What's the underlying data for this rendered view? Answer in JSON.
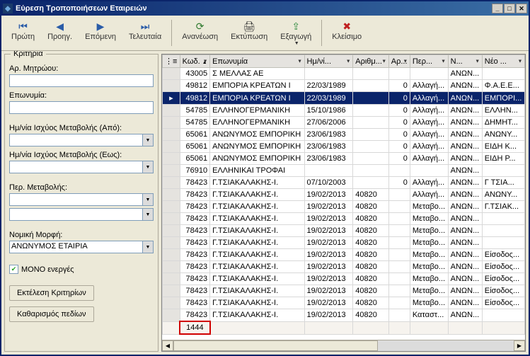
{
  "window": {
    "title": "Εύρεση Τροποποιήσεων Εταιρειών"
  },
  "toolbar": {
    "first": "Πρώτη",
    "prev": "Προηγ.",
    "next": "Επόμενη",
    "last": "Τελευταία",
    "refresh": "Ανανέωση",
    "print": "Εκτύπωση",
    "export": "Εξαγωγή",
    "close": "Κλείσιμο"
  },
  "criteria": {
    "legend": "Κριτήρια",
    "registryLabel": "Αρ. Μητρώου:",
    "nameLabel": "Επωνυμία:",
    "dateFromLabel": "Ημ/νία Ισχύος Μεταβολής (Από):",
    "dateToLabel": "Ημ/νία Ισχύος Μεταβολής (Εως):",
    "changeCatLabel": "Περ. Μεταβολής:",
    "legalFormLabel": "Νομική Μορφή:",
    "legalFormValue": "ΑΝΩΝΥΜΟΣ ΕΤΑΙΡΙΑ",
    "onlyActiveLabel": "ΜΟΝΟ ενεργές",
    "runBtn": "Εκτέλεση Κριτηρίων",
    "clearBtn": "Καθαρισμός πεδίων"
  },
  "grid": {
    "headers": [
      "Κωδ.",
      "Επωνυμία",
      "Ημ/νί...",
      "Αριθμ...",
      "Αρ...",
      "Περ...",
      "Ν...",
      "Νέο ..."
    ],
    "rows": [
      {
        "kod": "43005",
        "name": "Σ ΜΕΛΛΑΣ ΑΕ",
        "date": "",
        "num": "",
        "ar": "",
        "per": "",
        "n": "ΑΝΩΝ...",
        "neo": "",
        "sel": false
      },
      {
        "kod": "49812",
        "name": "ΕΜΠΟΡΙΑ ΚΡΕΑΤΩΝ Ι",
        "date": "22/03/1989",
        "num": "",
        "ar": "0",
        "per": "Αλλαγή...",
        "n": "ΑΝΩΝ...",
        "neo": "Φ.Α.Ε.Ε...",
        "sel": false
      },
      {
        "kod": "49812",
        "name": "ΕΜΠΟΡΙΑ ΚΡΕΑΤΩΝ Ι",
        "date": "22/03/1989",
        "num": "",
        "ar": "0",
        "per": "Αλλαγή...",
        "n": "ΑΝΩΝ...",
        "neo": "ΕΜΠΟΡΙ...",
        "sel": true
      },
      {
        "kod": "54785",
        "name": "ΕΛΛΗΝΟΓΕΡΜΑΝΙΚΗ",
        "date": "15/10/1986",
        "num": "",
        "ar": "0",
        "per": "Αλλαγή...",
        "n": "ΑΝΩΝ...",
        "neo": "ΕΛΛΗΝ...",
        "sel": false
      },
      {
        "kod": "54785",
        "name": "ΕΛΛΗΝΟΓΕΡΜΑΝΙΚΗ",
        "date": "27/06/2006",
        "num": "",
        "ar": "0",
        "per": "Αλλαγή...",
        "n": "ΑΝΩΝ...",
        "neo": "ΔΗΜΗΤ...",
        "sel": false
      },
      {
        "kod": "65061",
        "name": "ΑΝΩΝΥΜΟΣ ΕΜΠΟΡΙΚΗ",
        "date": "23/06/1983",
        "num": "",
        "ar": "0",
        "per": "Αλλαγή...",
        "n": "ΑΝΩΝ...",
        "neo": "ΑΝΩΝΥ...",
        "sel": false
      },
      {
        "kod": "65061",
        "name": "ΑΝΩΝΥΜΟΣ ΕΜΠΟΡΙΚΗ",
        "date": "23/06/1983",
        "num": "",
        "ar": "0",
        "per": "Αλλαγή...",
        "n": "ΑΝΩΝ...",
        "neo": "ΕΙΔΗ Κ...",
        "sel": false
      },
      {
        "kod": "65061",
        "name": "ΑΝΩΝΥΜΟΣ ΕΜΠΟΡΙΚΗ",
        "date": "23/06/1983",
        "num": "",
        "ar": "0",
        "per": "Αλλαγή...",
        "n": "ΑΝΩΝ...",
        "neo": "ΕΙΔΗ Ρ...",
        "sel": false
      },
      {
        "kod": "76910",
        "name": "ΕΛΛΗΝΙΚΑΙ ΤΡΟΦΑΙ",
        "date": "",
        "num": "",
        "ar": "",
        "per": "",
        "n": "ΑΝΩΝ...",
        "neo": "",
        "sel": false
      },
      {
        "kod": "78423",
        "name": "Γ.ΤΣΙΑΚΑΛΑΚΗΣ-Ι.",
        "date": "07/10/2003",
        "num": "",
        "ar": "0",
        "per": "Αλλαγή...",
        "n": "ΑΝΩΝ...",
        "neo": "Γ  ΤΣΙΑ...",
        "sel": false
      },
      {
        "kod": "78423",
        "name": "Γ.ΤΣΙΑΚΑΛΑΚΗΣ-Ι.",
        "date": "19/02/2013",
        "num": "40820",
        "ar": "",
        "per": "Αλλαγή...",
        "n": "ΑΝΩΝ...",
        "neo": "ΑΝΩΝΥ...",
        "sel": false
      },
      {
        "kod": "78423",
        "name": "Γ.ΤΣΙΑΚΑΛΑΚΗΣ-Ι.",
        "date": "19/02/2013",
        "num": "40820",
        "ar": "",
        "per": "Μεταβο...",
        "n": "ΑΝΩΝ...",
        "neo": "Γ.ΤΣΙΑΚ...",
        "sel": false
      },
      {
        "kod": "78423",
        "name": "Γ.ΤΣΙΑΚΑΛΑΚΗΣ-Ι.",
        "date": "19/02/2013",
        "num": "40820",
        "ar": "",
        "per": "Μεταβο...",
        "n": "ΑΝΩΝ...",
        "neo": "",
        "sel": false
      },
      {
        "kod": "78423",
        "name": "Γ.ΤΣΙΑΚΑΛΑΚΗΣ-Ι.",
        "date": "19/02/2013",
        "num": "40820",
        "ar": "",
        "per": "Μεταβο...",
        "n": "ΑΝΩΝ...",
        "neo": "",
        "sel": false
      },
      {
        "kod": "78423",
        "name": "Γ.ΤΣΙΑΚΑΛΑΚΗΣ-Ι.",
        "date": "19/02/2013",
        "num": "40820",
        "ar": "",
        "per": "Μεταβο...",
        "n": "ΑΝΩΝ...",
        "neo": "",
        "sel": false
      },
      {
        "kod": "78423",
        "name": "Γ.ΤΣΙΑΚΑΛΑΚΗΣ-Ι.",
        "date": "19/02/2013",
        "num": "40820",
        "ar": "",
        "per": "Μεταβο...",
        "n": "ΑΝΩΝ...",
        "neo": "Είσοδος...",
        "sel": false
      },
      {
        "kod": "78423",
        "name": "Γ.ΤΣΙΑΚΑΛΑΚΗΣ-Ι.",
        "date": "19/02/2013",
        "num": "40820",
        "ar": "",
        "per": "Μεταβο...",
        "n": "ΑΝΩΝ...",
        "neo": "Είσοδος...",
        "sel": false
      },
      {
        "kod": "78423",
        "name": "Γ.ΤΣΙΑΚΑΛΑΚΗΣ-Ι.",
        "date": "19/02/2013",
        "num": "40820",
        "ar": "",
        "per": "Μεταβο...",
        "n": "ΑΝΩΝ...",
        "neo": "Είσοδος...",
        "sel": false
      },
      {
        "kod": "78423",
        "name": "Γ.ΤΣΙΑΚΑΛΑΚΗΣ-Ι.",
        "date": "19/02/2013",
        "num": "40820",
        "ar": "",
        "per": "Μεταβο...",
        "n": "ΑΝΩΝ...",
        "neo": "Είσοδος...",
        "sel": false
      },
      {
        "kod": "78423",
        "name": "Γ.ΤΣΙΑΚΑΛΑΚΗΣ-Ι.",
        "date": "19/02/2013",
        "num": "40820",
        "ar": "",
        "per": "Μεταβο...",
        "n": "ΑΝΩΝ...",
        "neo": "Είσοδος...",
        "sel": false
      },
      {
        "kod": "78423",
        "name": "Γ.ΤΣΙΑΚΑΛΑΚΗΣ-Ι.",
        "date": "19/02/2013",
        "num": "40820",
        "ar": "",
        "per": "Καταστ...",
        "n": "ΑΝΩΝ...",
        "neo": "",
        "sel": false
      }
    ],
    "count": "1444"
  }
}
